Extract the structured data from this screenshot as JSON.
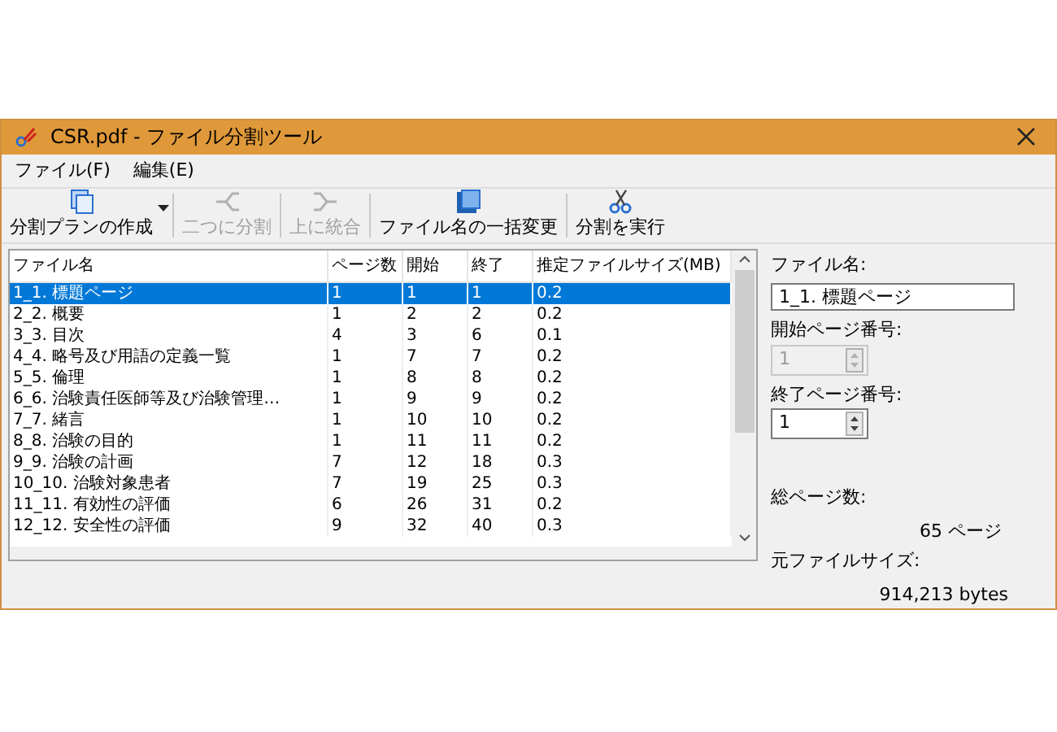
{
  "window": {
    "title": "CSR.pdf - ファイル分割ツール"
  },
  "menu": [
    "ファイル(F)",
    "編集(E)"
  ],
  "toolbar": [
    {
      "kind": "plan",
      "label": "分割プランの作成",
      "disabled": false,
      "dropdown": true
    },
    {
      "kind": "split",
      "label": "二つに分割",
      "disabled": true,
      "dropdown": false
    },
    {
      "kind": "merge",
      "label": "上に統合",
      "disabled": true,
      "dropdown": false
    },
    {
      "kind": "rename",
      "label": "ファイル名の一括変更",
      "disabled": false,
      "dropdown": false
    },
    {
      "kind": "run",
      "label": "分割を実行",
      "disabled": false,
      "dropdown": false
    }
  ],
  "table": {
    "columns": [
      "ファイル名",
      "ページ数",
      "開始",
      "終了",
      "推定ファイルサイズ(MB)"
    ],
    "rows": [
      {
        "cells": [
          "1_1. 標題ページ",
          "1",
          "1",
          "1",
          "0.2"
        ],
        "selected": true
      },
      {
        "cells": [
          "2_2. 概要",
          "1",
          "2",
          "2",
          "0.2"
        ],
        "selected": false
      },
      {
        "cells": [
          "3_3. 目次",
          "4",
          "3",
          "6",
          "0.1"
        ],
        "selected": false
      },
      {
        "cells": [
          "4_4. 略号及び用語の定義一覧",
          "1",
          "7",
          "7",
          "0.2"
        ],
        "selected": false
      },
      {
        "cells": [
          "5_5. 倫理",
          "1",
          "8",
          "8",
          "0.2"
        ],
        "selected": false
      },
      {
        "cells": [
          "6_6. 治験責任医師等及び治験管理…",
          "1",
          "9",
          "9",
          "0.2"
        ],
        "selected": false
      },
      {
        "cells": [
          "7_7. 緒言",
          "1",
          "10",
          "10",
          "0.2"
        ],
        "selected": false
      },
      {
        "cells": [
          "8_8. 治験の目的",
          "1",
          "11",
          "11",
          "0.2"
        ],
        "selected": false
      },
      {
        "cells": [
          "9_9. 治験の計画",
          "7",
          "12",
          "18",
          "0.3"
        ],
        "selected": false
      },
      {
        "cells": [
          "10_10. 治験対象患者",
          "7",
          "19",
          "25",
          "0.3"
        ],
        "selected": false
      },
      {
        "cells": [
          "11_11. 有効性の評価",
          "6",
          "26",
          "31",
          "0.2"
        ],
        "selected": false
      },
      {
        "cells": [
          "12_12. 安全性の評価",
          "9",
          "32",
          "40",
          "0.3"
        ],
        "selected": false
      }
    ]
  },
  "details": {
    "file_name": {
      "label": "ファイル名:",
      "value": "1_1. 標題ページ"
    },
    "start_page": {
      "label": "開始ページ番号:",
      "value": "1",
      "disabled": true
    },
    "end_page": {
      "label": "終了ページ番号:",
      "value": "1",
      "disabled": false
    },
    "total_pages": {
      "label": "総ページ数:",
      "value": "65 ページ"
    },
    "file_size": {
      "label": "元ファイルサイズ:",
      "value": "914,213 bytes"
    }
  }
}
